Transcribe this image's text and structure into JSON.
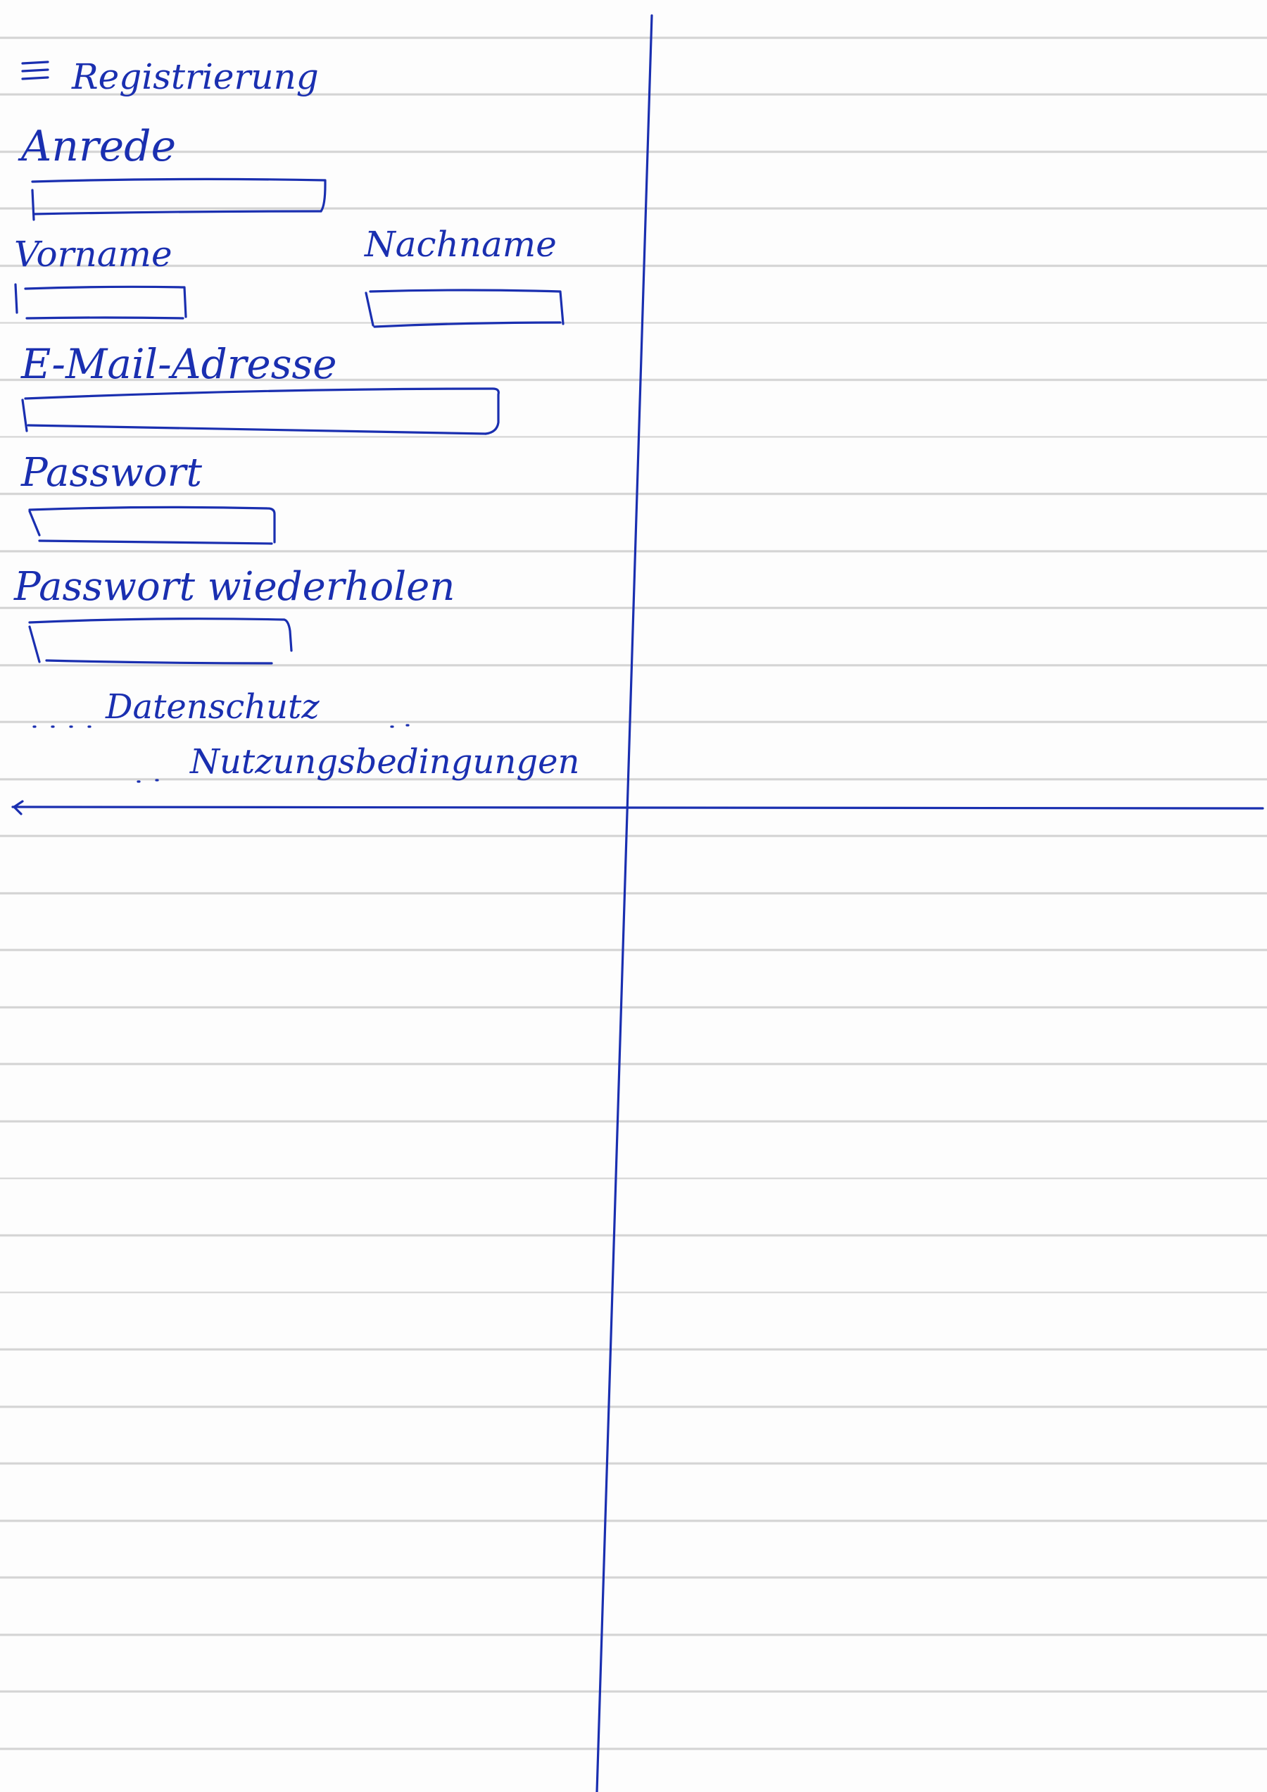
{
  "sketch": {
    "menu_icon": "hamburger-menu-icon",
    "title": "Registrierung",
    "fields": {
      "salutation": {
        "label": "Anrede"
      },
      "first_name": {
        "label": "Vorname"
      },
      "last_name": {
        "label": "Nachname"
      },
      "email": {
        "label": "E-Mail-Adresse"
      },
      "password": {
        "label": "Passwort"
      },
      "password_repeat": {
        "label": "Passwort wiederholen"
      }
    },
    "links": {
      "privacy": "Datenschutz",
      "terms": "Nutzungsbedingungen"
    },
    "back_icon": "back-arrow-icon",
    "ink_color": "#1a2fb0",
    "paper_line_color": "#d4d4d4"
  }
}
